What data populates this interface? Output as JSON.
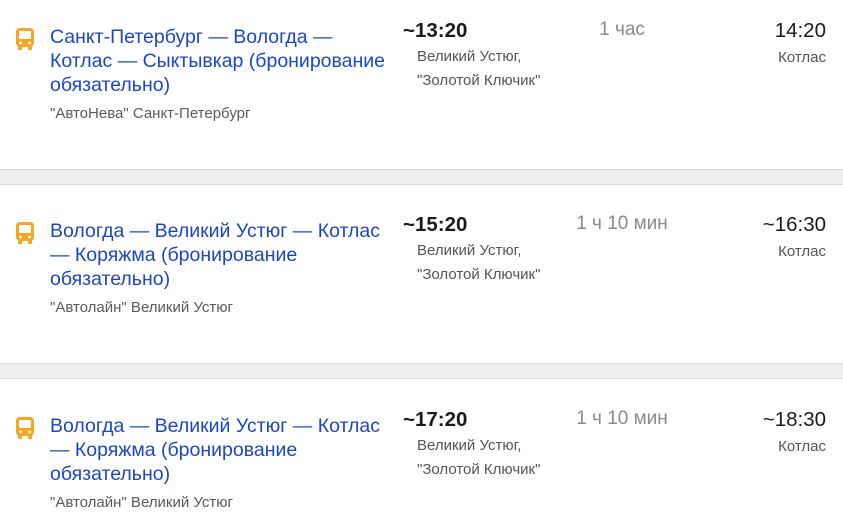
{
  "trips": [
    {
      "route": "Санкт-Петербург — Вологда — Котлас — Сыктывкар (бронирование обязательно)",
      "carrier": "\"АвтоНева\" Санкт-Петербург",
      "departure_time": "~13:20",
      "stop_line1": "Великий Устюг,",
      "stop_line2": "\"Золотой Ключик\"",
      "duration": "1 час",
      "arrival_time": "14:20",
      "arrival_city": "Котлас"
    },
    {
      "route": "Вологда — Великий Устюг — Котлас — Коряжма (бронирование обязательно)",
      "carrier": "\"Автолайн\" Великий Устюг",
      "departure_time": "~15:20",
      "stop_line1": "Великий Устюг,",
      "stop_line2": "\"Золотой Ключик\"",
      "duration": "1 ч 10 мин",
      "arrival_time": "~16:30",
      "arrival_city": "Котлас"
    },
    {
      "route": "Вологда — Великий Устюг — Котлас — Коряжма (бронирование обязательно)",
      "carrier": "\"Автолайн\" Великий Устюг",
      "departure_time": "~17:20",
      "stop_line1": "Великий Устюг,",
      "stop_line2": "\"Золотой Ключик\"",
      "duration": "1 ч 10 мин",
      "arrival_time": "~18:30",
      "arrival_city": "Котлас"
    }
  ],
  "colors": {
    "link": "#1b47c5",
    "bus_icon": "#f5a623",
    "separator": "#efefef"
  },
  "icon": "bus-icon"
}
